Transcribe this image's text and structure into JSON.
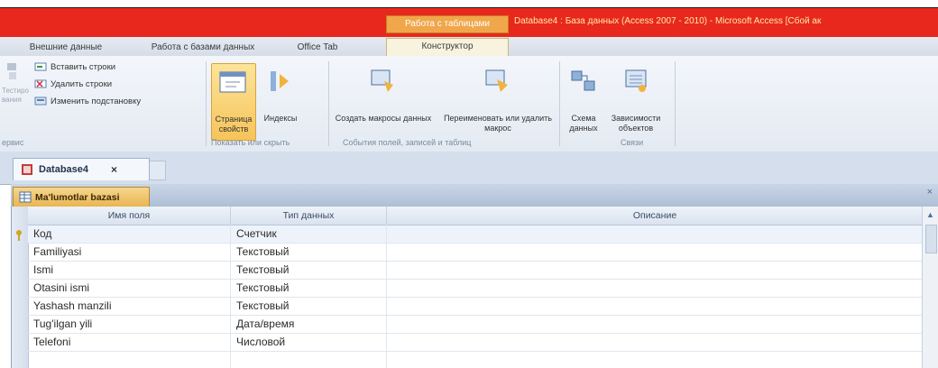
{
  "window": {
    "context_tab_label": "Работа с таблицами",
    "title": "Database4 : База данных (Access 2007 - 2010) - Microsoft Access [Сбой ак"
  },
  "ribbon_tabs": [
    {
      "label": "Внешние данные"
    },
    {
      "label": "Работа с базами данных"
    },
    {
      "label": "Office Tab"
    },
    {
      "label": "Конструктор"
    }
  ],
  "ribbon": {
    "rows_group": {
      "insert_rows": "Вставить строки",
      "delete_rows": "Удалить строки",
      "change_lookup": "Изменить подстановку"
    },
    "left_partial": {
      "label1": "Тестиро",
      "label2": "вания",
      "group": "ервис"
    },
    "show_hide": {
      "property_sheet": "Страница свойств",
      "indexes": "Индексы",
      "group_label": "Показать или скрыть"
    },
    "events": {
      "create_macros": "Создать макросы данных",
      "rename_macros": "Переименовать или удалить макрос",
      "group_label": "События полей, записей и таблиц"
    },
    "relations": {
      "data_schema": "Схема данных",
      "dependencies": "Зависимости объектов",
      "group_label": "Связи"
    }
  },
  "document_tab": {
    "label": "Database4"
  },
  "object_tab": {
    "label": "Ma'lumotlar bazasi"
  },
  "grid": {
    "columns": [
      "Имя поля",
      "Тип данных",
      "Описание"
    ],
    "rows": [
      {
        "field": "Код",
        "type": "Счетчик",
        "description": ""
      },
      {
        "field": "Familiyasi",
        "type": "Текстовый",
        "description": ""
      },
      {
        "field": "Ismi",
        "type": "Текстовый",
        "description": ""
      },
      {
        "field": "Otasini ismi",
        "type": "Текстовый",
        "description": ""
      },
      {
        "field": "Yashash manzili",
        "type": "Текстовый",
        "description": ""
      },
      {
        "field": "Tug'ilgan yili",
        "type": "Дата/время",
        "description": ""
      },
      {
        "field": "Telefoni",
        "type": "Числовой",
        "description": ""
      }
    ]
  },
  "colors": {
    "title_bar": "#e8281d",
    "context_tab": "#f0a64a",
    "ribbon_bg": "#e4eaf2",
    "object_tab": "#e9b44f"
  }
}
